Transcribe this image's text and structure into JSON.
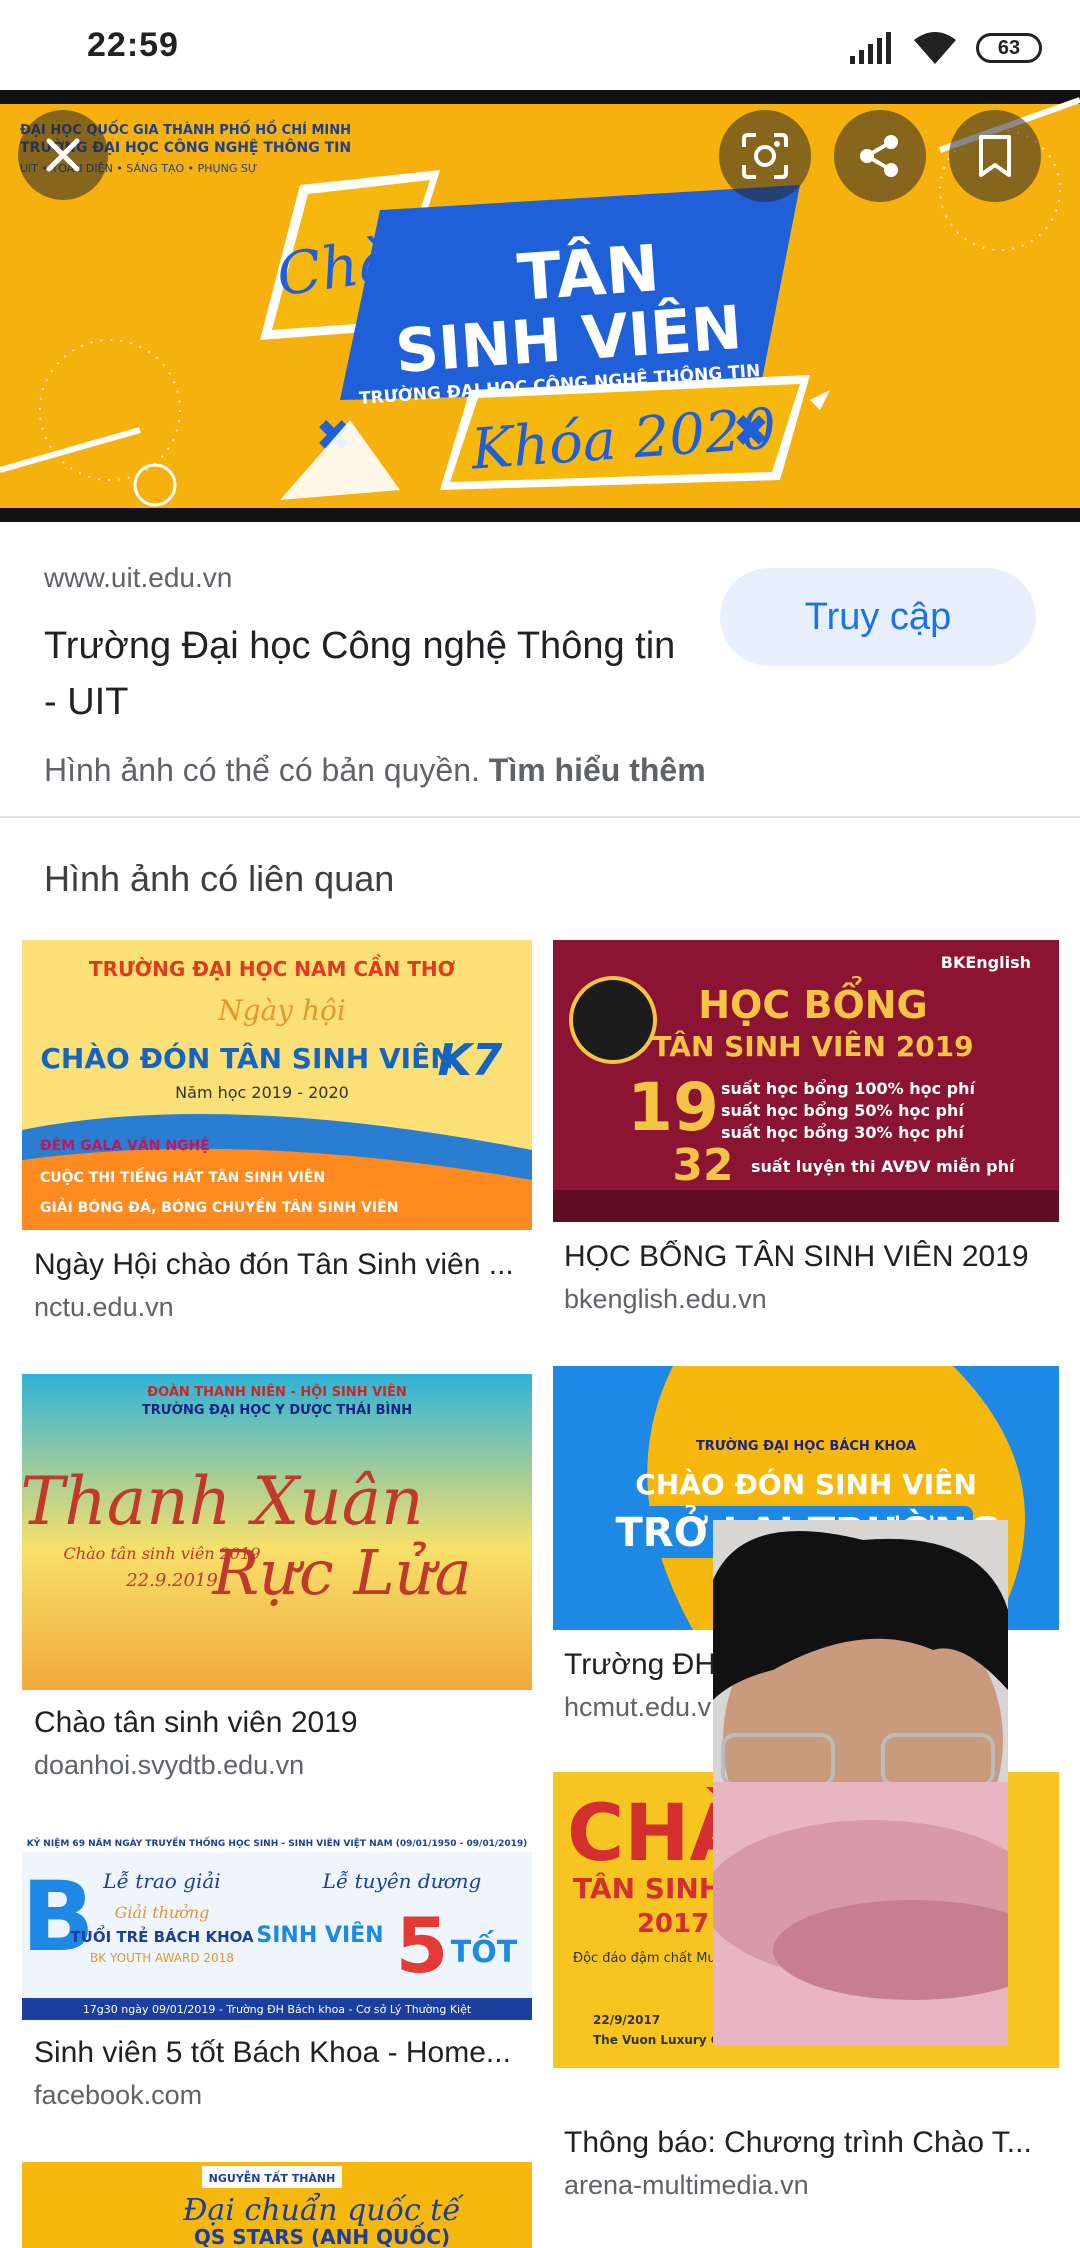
{
  "status": {
    "time": "22:59",
    "battery": "63"
  },
  "hero": {
    "banner_school_line1": "ĐẠI HỌC QUỐC GIA THÀNH PHỐ HỒ CHÍ MINH",
    "banner_school_line2": "TRƯỜNG ĐẠI HỌC CÔNG NGHỆ THÔNG TIN",
    "banner_motto": "UIT  •  TOÀN DIỆN  •  SÁNG TẠO  •  PHỤNG SỰ",
    "banner_chao": "Chào",
    "banner_tan": "TÂN",
    "banner_sinhvien": "SINH VIÊN",
    "banner_truong": "TRƯỜNG ĐẠI HỌC CÔNG NGHỆ THÔNG TIN",
    "banner_khoa": "Khóa 2020"
  },
  "result": {
    "domain": "www.uit.edu.vn",
    "title": "Trường Đại học Công nghệ Thông tin - UIT",
    "visit_label": "Truy cập",
    "copyright_text": "Hình ảnh có thể có bản quyền.",
    "learn_more": "Tìm hiểu thêm"
  },
  "related_heading": "Hình ảnh có liên quan",
  "related": [
    {
      "caption": "Ngày Hội chào đón Tân Sinh viên ...",
      "source": "nctu.edu.vn",
      "img_title": "TRƯỜNG ĐẠI HỌC NAM CẦN THƠ",
      "img_sub": "Ngày hội",
      "img_main": "CHÀO ĐÓN TÂN SINH VIÊN",
      "img_k": "K7",
      "img_year": "Năm học 2019 - 2020",
      "img_l1": "ĐÊM GALA VĂN NGHỆ",
      "img_l2": "CUỘC THI TIẾNG HÁT TÂN SINH VIÊN",
      "img_l3": "GIẢI BÓNG ĐÁ, BÓNG CHUYỀN TÂN SINH VIÊN"
    },
    {
      "caption": "HỌC BỔNG TÂN SINH VIÊN 2019",
      "source": "bkenglish.edu.vn",
      "img_title": "HỌC BỔNG",
      "img_sub": "TÂN SINH VIÊN 2019",
      "img_19": "19",
      "img_32": "32",
      "img_l1": "suất học bổng 100% học phí",
      "img_l2": "suất học bổng 50% học phí",
      "img_l3": "suất học bổng 30% học phí",
      "img_l4": "suất luyện thi AVĐV miễn phí",
      "img_brand": "BKEnglish"
    },
    {
      "caption": "Chào tân sinh viên 2019",
      "source": "doanhoi.svydtb.edu.vn",
      "img_top": "ĐOÀN THANH NIÊN - HỘI SINH VIÊN",
      "img_top2": "TRƯỜNG ĐẠI HỌC Y DƯỢC THÁI BÌNH",
      "img_main1": "Thanh Xuân",
      "img_main2": "Rực Lửa",
      "img_sub": "Chào tân sinh viên 2019",
      "img_date": "22.9.2019"
    },
    {
      "caption": "Trường ĐH Bách Khoa ...",
      "source": "hcmut.edu.vn",
      "img_school": "TRƯỜNG ĐẠI HỌC BÁCH KHOA",
      "img_main": "CHÀO ĐÓN SINH VIÊN",
      "img_main2": "TRỞ LẠI TRƯỜNG"
    },
    {
      "caption": "Sinh viên 5 tốt Bách Khoa - Home...",
      "source": "facebook.com",
      "img_top": "KỶ NIỆM 69 NĂM NGÀY TRUYỀN THỐNG HỌC SINH - SINH VIÊN VIỆT NAM (09/01/1950 - 09/01/2019)",
      "img_a": "Lễ trao giải",
      "img_b": "Giải thưởng",
      "img_c": "TUỔI TRẺ BÁCH KHOA",
      "img_d": "BK YOUTH AWARD 2018",
      "img_e": "Lễ tuyên dương",
      "img_f": "SINH VIÊN",
      "img_g": "5",
      "img_h": "TỐT",
      "img_bottom": "17g30 ngày 09/01/2019 - Trường ĐH Bách khoa - Cơ sở Lý Thường Kiệt"
    },
    {
      "caption": "Thông báo: Chương trình Chào T...",
      "source": "arena-multimedia.vn",
      "img_main": "CHÀO",
      "img_sub": "TÂN SINH VIÊN",
      "img_year": "2017",
      "img_desc": "Độc đáo đậm chất Multimedia",
      "img_date": "22/9/2017",
      "img_venue": "The Vuon Luxury Garden"
    },
    {
      "caption": "",
      "source": "",
      "img_top": "NGUYỄN TẤT THÀNH",
      "img_main": "Đại chuẩn quốc tế",
      "img_sub": "QS STARS (ANH QUỐC)"
    }
  ],
  "colors": {
    "accent": "#1a73e8",
    "visit_bg": "#e8f0fe",
    "banner_yellow": "#f7b80d",
    "banner_blue": "#1f5fd8"
  },
  "icons": [
    "close-icon",
    "lens-icon",
    "share-icon",
    "bookmark-icon",
    "signal-icon",
    "wifi-icon",
    "battery-icon"
  ]
}
